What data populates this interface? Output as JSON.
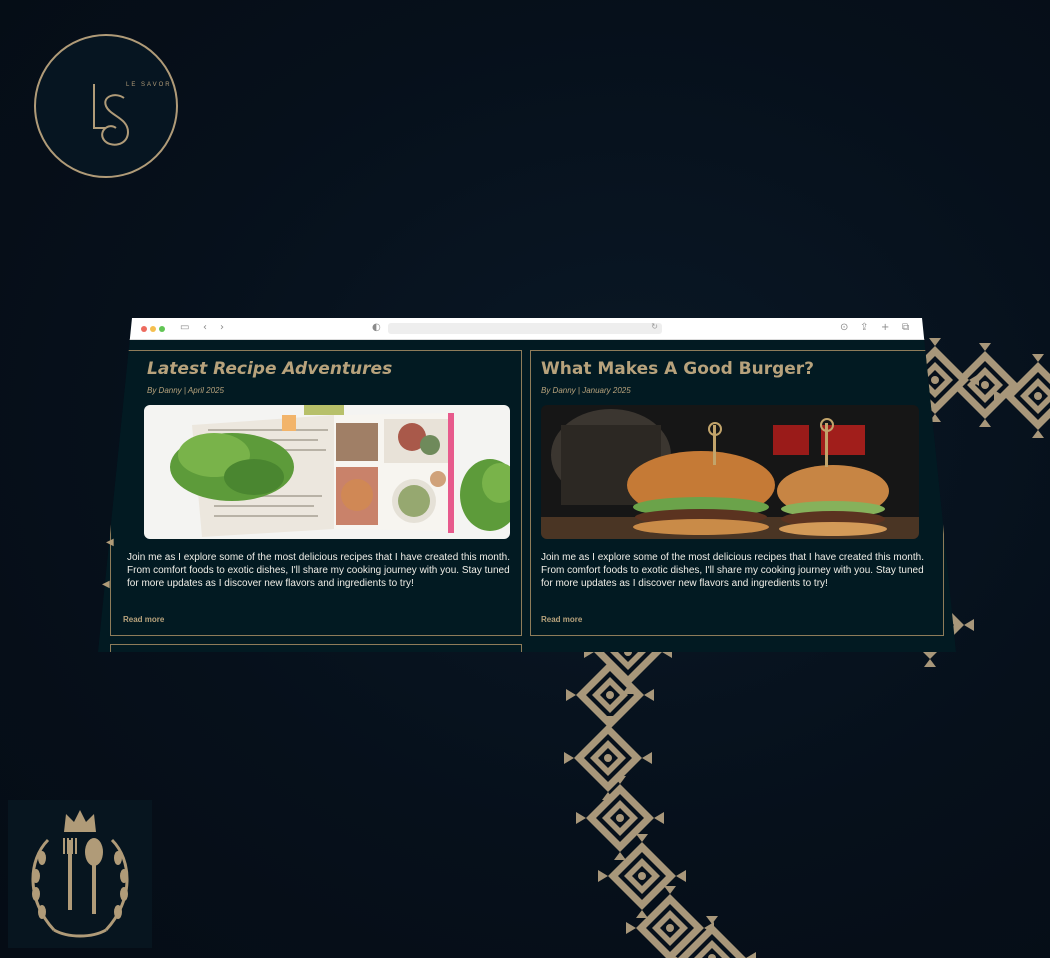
{
  "brand": {
    "logo_monogram": "LS",
    "logo_wordmark": "LE SAVOR"
  },
  "browser": {
    "toolbar_icons": [
      "sidebar-icon",
      "back-icon",
      "forward-icon",
      "privacy-icon",
      "reload-icon",
      "download-icon",
      "share-icon",
      "new-tab-icon",
      "tabs-icon"
    ]
  },
  "posts": [
    {
      "title": "Latest Recipe Adventures",
      "meta": "By Danny | April 2025",
      "image": "cookbook-with-lettuce",
      "excerpt": "Join me as I explore some of the most delicious recipes that I have created this month. From comfort foods to exotic dishes, I'll share my cooking journey with you. Stay tuned for more updates as I discover new flavors and ingredients to try!",
      "link": "Read more"
    },
    {
      "title": "What Makes A Good Burger?",
      "meta": "By Danny | January 2025",
      "image": "two-burgers-with-cola",
      "excerpt": "Join me as I explore some of the most delicious recipes that I have created this month. From comfort foods to exotic dishes, I'll share my cooking journey with you. Stay tuned for more updates as I discover new flavors and ingredients to try!",
      "link": "Read more"
    }
  ],
  "colors": {
    "background": "#06101b",
    "gold": "#b09b78",
    "card_bg": "#021a22",
    "text": "#f1efe8"
  }
}
